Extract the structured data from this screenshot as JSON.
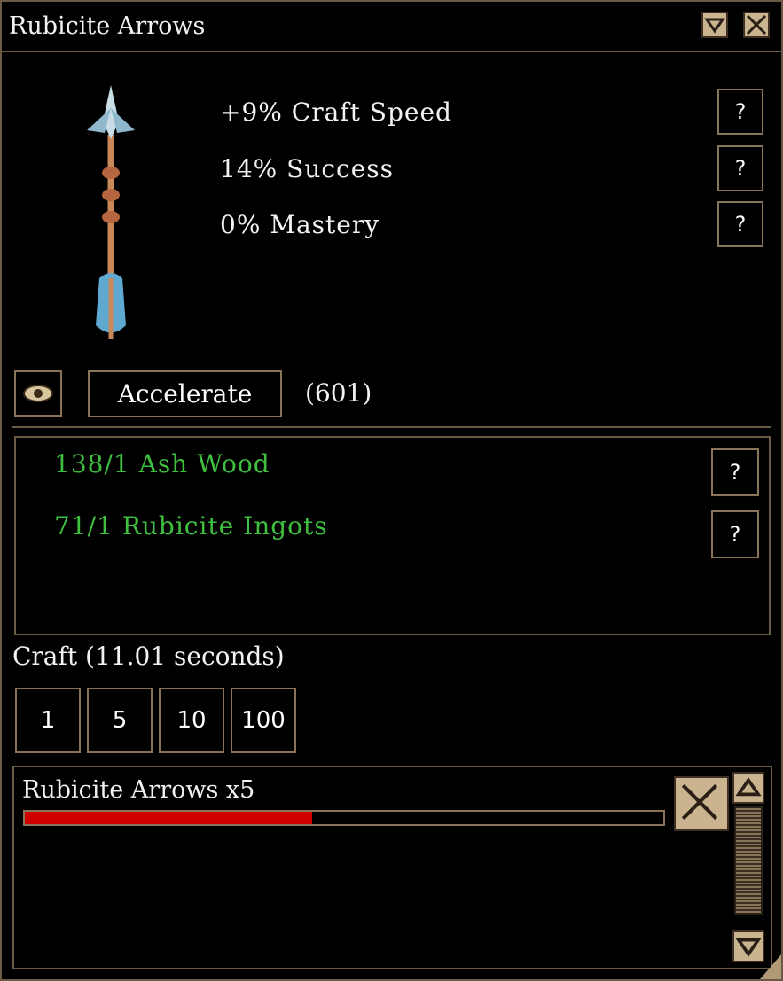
{
  "window": {
    "title": "Rubicite Arrows"
  },
  "stats": [
    {
      "label": "+9% Craft Speed",
      "help": "?"
    },
    {
      "label": "14% Success",
      "help": "?"
    },
    {
      "label": "0% Mastery",
      "help": "?"
    }
  ],
  "accelerate": {
    "label": "Accelerate",
    "count": "(601)"
  },
  "resources": [
    {
      "label": "138/1 Ash Wood",
      "help": "?"
    },
    {
      "label": "71/1 Rubicite Ingots",
      "help": "?"
    }
  ],
  "craft": {
    "label": "Craft (11.01 seconds)",
    "quantities": [
      "1",
      "5",
      "10",
      "100"
    ]
  },
  "queue": {
    "items": [
      {
        "name": "Rubicite Arrows x5",
        "progress": 0.45
      }
    ]
  },
  "colors": {
    "resource_text": "#3fbf3f",
    "progress_fill": "#d10000",
    "frame": "#6b5a45"
  },
  "icons": {
    "collapse": "triangle-down-icon",
    "close": "close-icon",
    "view": "eye-icon",
    "scroll_up": "triangle-up-icon",
    "scroll_down": "triangle-down-icon"
  }
}
